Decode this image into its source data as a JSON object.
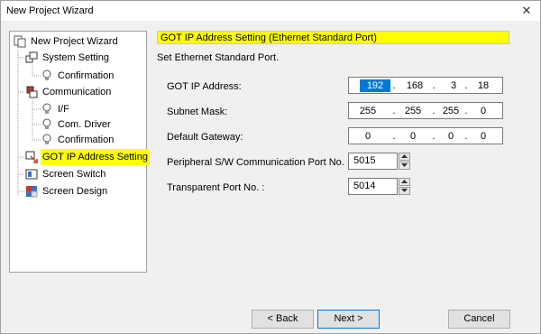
{
  "window": {
    "title": "New Project Wizard"
  },
  "tree": {
    "items": [
      {
        "label": "New Project Wizard",
        "icon": "wizard-icon"
      },
      {
        "label": "System Setting",
        "icon": "system-setting-icon"
      },
      {
        "label": "Confirmation",
        "icon": "lightbulb-icon"
      },
      {
        "label": "Communication",
        "icon": "communication-icon"
      },
      {
        "label": "I/F",
        "icon": "lightbulb-icon"
      },
      {
        "label": "Com. Driver",
        "icon": "lightbulb-icon"
      },
      {
        "label": "Confirmation",
        "icon": "lightbulb-icon"
      },
      {
        "label": "GOT IP Address Setting",
        "icon": "got-ip-icon",
        "selected": true
      },
      {
        "label": "Screen Switch",
        "icon": "screen-switch-icon"
      },
      {
        "label": "Screen Design",
        "icon": "screen-design-icon"
      }
    ]
  },
  "panel": {
    "header": "GOT IP Address Setting (Ethernet Standard Port)",
    "subtitle": "Set Ethernet Standard Port."
  },
  "fields": {
    "got_ip": {
      "label": "GOT IP Address:",
      "octets": [
        "192",
        "168",
        "3",
        "18"
      ]
    },
    "subnet": {
      "label": "Subnet Mask:",
      "octets": [
        "255",
        "255",
        "255",
        "0"
      ]
    },
    "gateway": {
      "label": "Default Gateway:",
      "octets": [
        "0",
        "0",
        "0",
        "0"
      ]
    },
    "peripheral_port": {
      "label": "Peripheral S/W Communication Port No. :",
      "value": "5015"
    },
    "transparent_port": {
      "label": "Transparent Port No. :",
      "value": "5014"
    },
    "separator": "."
  },
  "buttons": {
    "back": "< Back",
    "next": "Next >",
    "cancel": "Cancel"
  },
  "colors": {
    "highlight": "#ffff00",
    "selection": "#0078d7"
  }
}
